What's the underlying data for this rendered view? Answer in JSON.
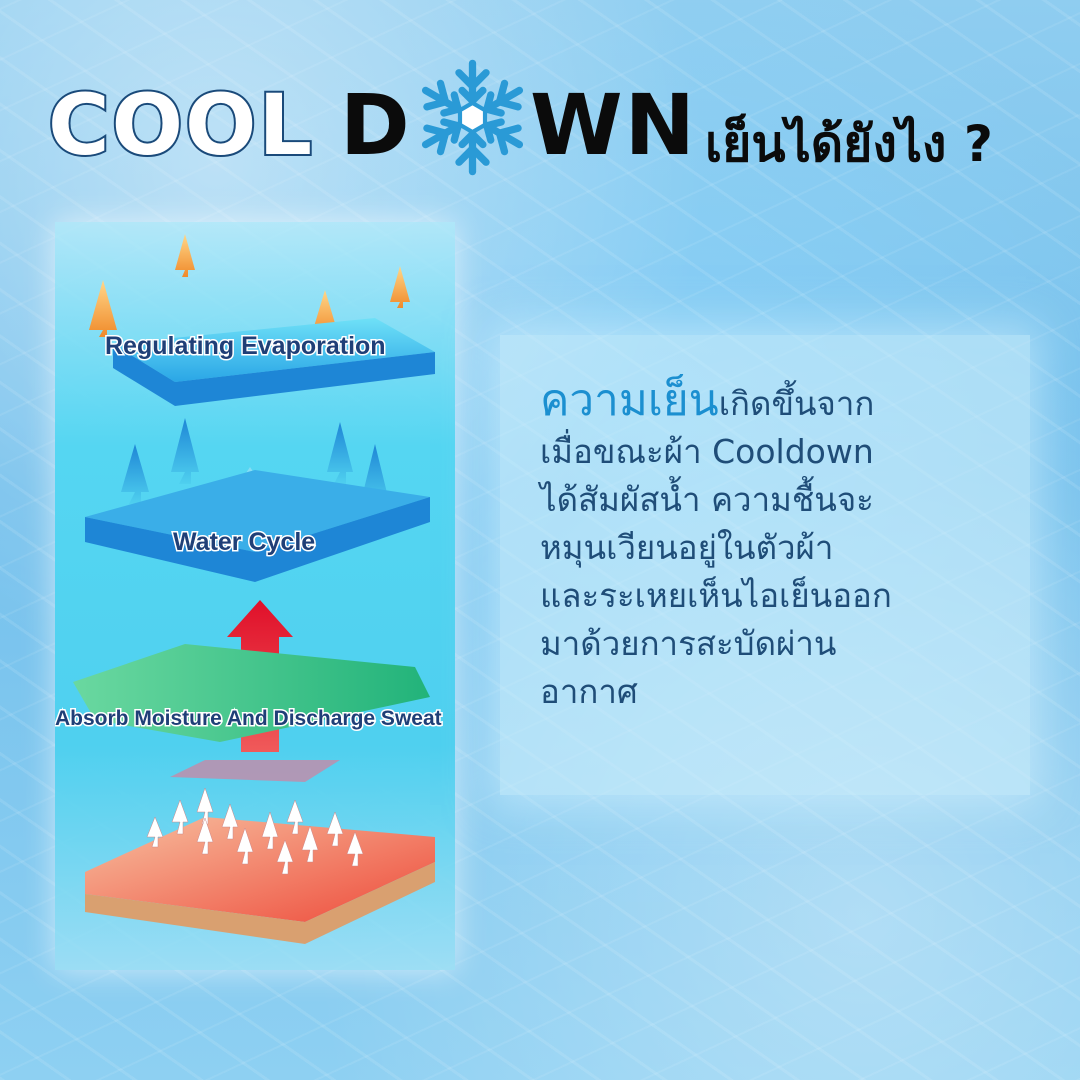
{
  "title": {
    "part_outline": "COOL",
    "part_d": "D",
    "part_wn": "WN",
    "part_thai": "เย็นได้ยังไง ?",
    "snowflake_icon": "snowflake-icon"
  },
  "diagram": {
    "layers": {
      "top": "Regulating Evaporation",
      "middle": "Water Cycle",
      "lower": "Absorb Moisture And Discharge Sweat"
    },
    "icons": [
      "heat-arrow-icon",
      "moisture-arrow-icon",
      "recycle-icon",
      "sweat-arrow-icon"
    ]
  },
  "card": {
    "highlight": "ความเย็น",
    "line1_rest": "เกิดขึ้นจาก",
    "lines": [
      "เมื่อขณะผ้า Cooldown",
      "ได้สัมผัสน้ำ ความชื้นจะ",
      "หมุนเวียนอยู่ในตัวผ้า",
      "และระเหยเห็นไอเย็นออก",
      "มาด้วยการสะบัดผ่าน",
      "อากาศ"
    ]
  },
  "colors": {
    "title_outline": "#1a4a7a",
    "snowflake": "#2a9ad6",
    "highlight": "#1b8fd0",
    "body_text": "#1f4d78"
  }
}
